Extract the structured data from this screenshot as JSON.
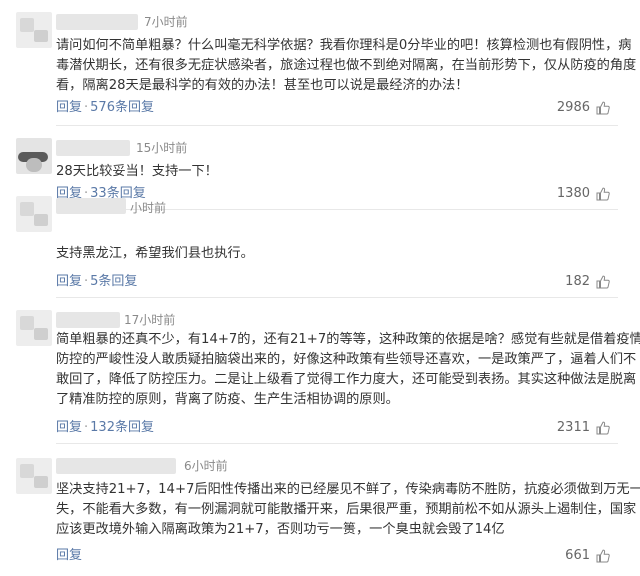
{
  "comments": [
    {
      "time": "7小时前",
      "lines": [
        "请问如何不简单粗暴？什么叫毫无科学依据？我看你理科是0分毕业的吧！核算检测也有假阴性，病",
        "毒潜伏期长，还有很多无症状感染者，旅途过程也做不到绝对隔离，在当前形势下，仅从防疫的角度",
        "看，隔离28天是最科学的有效的办法！甚至也可以说是最经济的办法！"
      ],
      "reply_label": "回复",
      "replies_label": "576条回复",
      "likes": "2986"
    },
    {
      "time": "15小时前",
      "lines": [
        "28天比较妥当！支持一下！"
      ],
      "reply_label": "回复",
      "replies_label": "33条回复",
      "likes": "1380"
    },
    {
      "time": "小时前",
      "lines": [
        "支持黑龙江，希望我们县也执行。"
      ],
      "reply_label": "回复",
      "replies_label": "5条回复",
      "likes": "182"
    },
    {
      "time": "17小时前",
      "lines": [
        "简单粗暴的还真不少，有14+7的，还有21+7的等等，这种政策的依据是啥？感觉有些就是借着疫情",
        "防控的严峻性没人敢质疑拍脑袋出来的，好像这种政策有些领导还喜欢，一是政策严了，逼着人们不",
        "敢回了，降低了防控压力。二是让上级看了觉得工作力度大，还可能受到表扬。其实这种做法是脱离",
        "了精准防控的原则，背离了防疫、生产生活相协调的原则。"
      ],
      "reply_label": "回复",
      "replies_label": "132条回复",
      "likes": "2311"
    },
    {
      "time": "6小时前",
      "lines": [
        "坚决支持21+7，14+7后阳性传播出来的已经屡见不鲜了，传染病毒防不胜防，抗疫必须做到万无一",
        "失，不能看大多数，有一例漏洞就可能散播开来，后果很严重，预期前松不如从源头上遏制住，国家",
        "应该更改境外输入隔离政策为21+7，否则功亏一篑，一个臭虫就会毁了14亿"
      ],
      "reply_label": "回复",
      "replies_label": "",
      "likes": "661"
    }
  ],
  "icons": {
    "like": "thumbs-up-icon"
  },
  "colors": {
    "link": "#5a79a7",
    "text": "#333333",
    "muted": "#8a8a8a"
  }
}
